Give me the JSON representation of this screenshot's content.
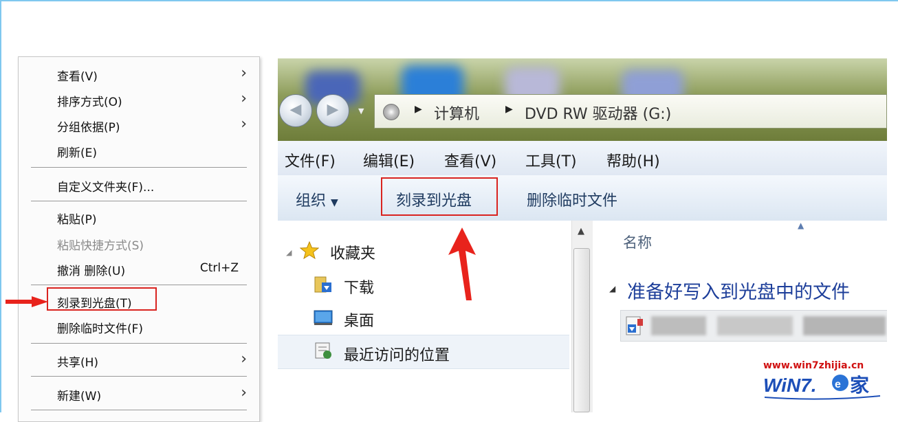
{
  "context_menu": {
    "view": "查看(V)",
    "sort_by": "排序方式(O)",
    "group_by": "分组依据(P)",
    "refresh": "刷新(E)",
    "customize_folder": "自定义文件夹(F)...",
    "paste": "粘贴(P)",
    "paste_shortcut": "粘贴快捷方式(S)",
    "undo_delete": "撤消 删除(U)",
    "undo_shortcut": "Ctrl+Z",
    "burn_to_disc": "刻录到光盘(T)",
    "delete_temp_files": "删除临时文件(F)",
    "share": "共享(H)",
    "new": "新建(W)"
  },
  "explorer": {
    "address": {
      "computer": "计算机",
      "drive": "DVD RW 驱动器 (G:)"
    },
    "menubar": {
      "file": "文件(F)",
      "edit": "编辑(E)",
      "view": "查看(V)",
      "tools": "工具(T)",
      "help": "帮助(H)"
    },
    "toolbar": {
      "organize": "组织",
      "burn_to_disc": "刻录到光盘",
      "delete_temp_files": "删除临时文件"
    },
    "nav_pane": {
      "favorites": "收藏夹",
      "downloads": "下载",
      "desktop": "桌面",
      "recent_places": "最近访问的位置"
    },
    "content": {
      "column_name": "名称",
      "group_header": "准备好写入到光盘中的文件"
    }
  },
  "watermark": {
    "url": "www.win7zhijia.cn",
    "logo_text": "WiN7.之家"
  },
  "colors": {
    "highlight_red": "#d9231f",
    "group_header_blue": "#1e3f9a"
  }
}
